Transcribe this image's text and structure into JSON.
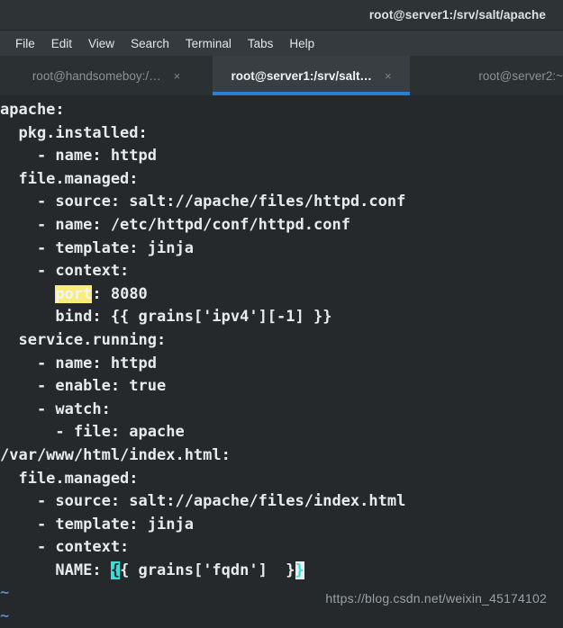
{
  "window": {
    "title": "root@server1:/srv/salt/apache"
  },
  "menubar": {
    "items": [
      {
        "label": "File"
      },
      {
        "label": "Edit"
      },
      {
        "label": "View"
      },
      {
        "label": "Search"
      },
      {
        "label": "Terminal"
      },
      {
        "label": "Tabs"
      },
      {
        "label": "Help"
      }
    ]
  },
  "tabs": [
    {
      "label": "root@handsomeboy:/…",
      "close": "×",
      "active": false
    },
    {
      "label": "root@server1:/srv/salt…",
      "close": "×",
      "active": true
    },
    {
      "label": "root@server2:~",
      "close": "",
      "active": false
    }
  ],
  "terminal": {
    "lines": [
      "apache:",
      "  pkg.installed:",
      "    - name: httpd",
      "  file.managed:",
      "    - source: salt://apache/files/httpd.conf",
      "    - name: /etc/httpd/conf/httpd.conf",
      "    - template: jinja",
      "    - context:",
      "  service.running:",
      "    - name: httpd",
      "    - enable: true",
      "    - watch:",
      "      - file: apache",
      "/var/www/html/index.html:",
      "  file.managed:",
      "    - source: salt://apache/files/index.html",
      "    - template: jinja",
      "    - context:"
    ],
    "port_line": {
      "indent": "      ",
      "highlighted": "port",
      "rest": ": 8080"
    },
    "bind_line": "      bind: {{ grains['ipv4'][-1] }}",
    "name_line": {
      "prefix": "      NAME: ",
      "brace_open": "{",
      "middle": "{ grains['fqdn']  }",
      "cursor": "}"
    },
    "empty_markers": [
      "~",
      "~"
    ]
  },
  "watermark": {
    "text": "https://blog.csdn.net/weixin_45174102"
  },
  "colors": {
    "titlebar_bg": "#2E3336",
    "menubar_bg": "#343B3F",
    "tabbar_bg": "#2B3033",
    "active_tab_bg": "#383E42",
    "active_tab_underline": "#2A7FD4",
    "terminal_bg": "#25292C",
    "terminal_fg": "#E8EBEC",
    "search_highlight": "#F9EC79",
    "brace_match": "#35E0D6",
    "cursor_bg": "#E9ECEC",
    "tilde": "#5E89C4"
  }
}
